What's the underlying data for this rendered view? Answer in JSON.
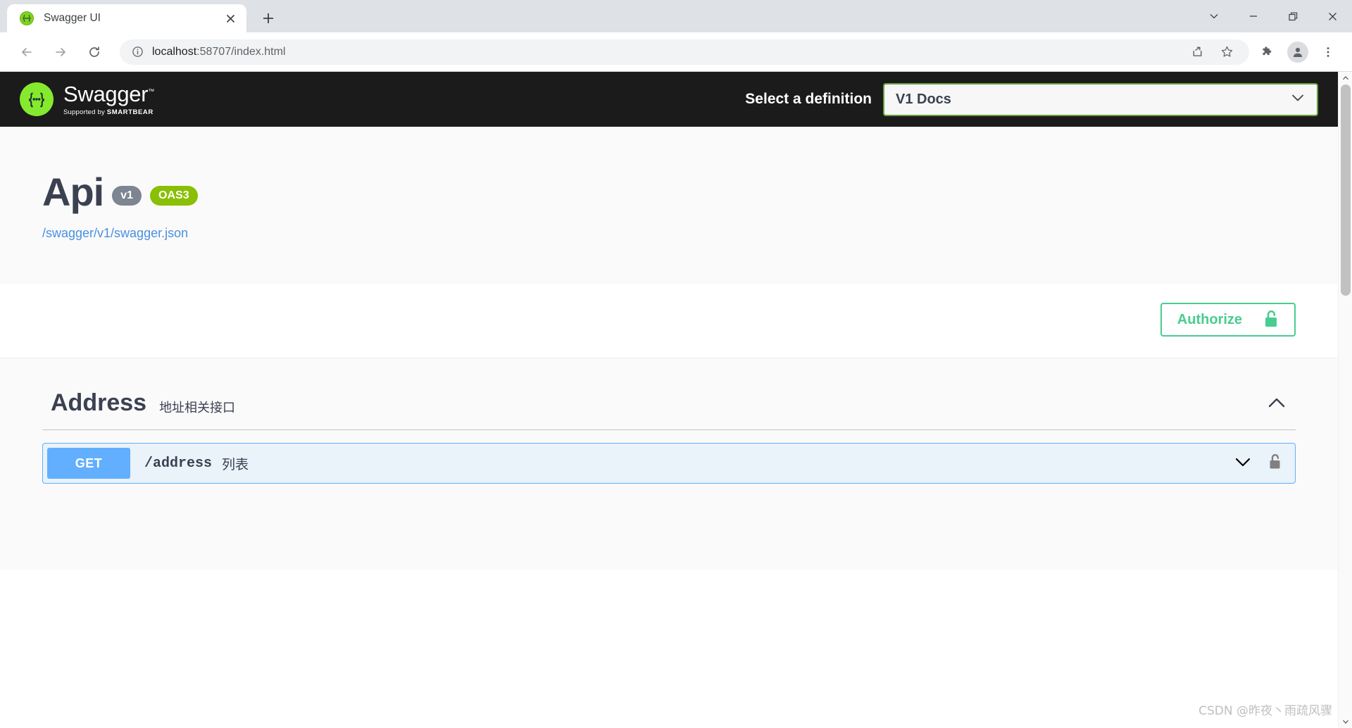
{
  "browser": {
    "tab": {
      "title": "Swagger UI",
      "favicon_icon": "swagger-favicon",
      "close_icon": "close-icon"
    },
    "new_tab_icon": "plus-icon",
    "window_controls": [
      {
        "name": "tab-search",
        "icon": "chevron-down-icon"
      },
      {
        "name": "minimize",
        "icon": "minimize-icon"
      },
      {
        "name": "maximize",
        "icon": "restore-icon"
      },
      {
        "name": "close",
        "icon": "close-icon"
      }
    ],
    "toolbar": {
      "back_icon": "back-arrow-icon",
      "forward_icon": "forward-arrow-icon",
      "reload_icon": "reload-icon",
      "site_info_icon": "info-circle-icon",
      "url_secure_part": "localhost",
      "url_rest": ":58707/index.html",
      "url_full": "localhost:58707/index.html",
      "share_icon": "share-icon",
      "bookmark_icon": "star-icon",
      "extensions_icon": "puzzle-icon",
      "profile_icon": "person-avatar-icon",
      "menu_icon": "three-dot-menu-icon"
    }
  },
  "swagger": {
    "topbar": {
      "logo_text": "Swagger",
      "logo_tm": "™",
      "logo_glyph": "{…}",
      "supported_by_prefix": "Supported by ",
      "supported_by_brand": "SMARTBEAR",
      "definition_label": "Select a definition",
      "definition_value": "V1 Docs",
      "definition_chevron_icon": "chevron-down-icon"
    },
    "info": {
      "title": "Api",
      "version_badge": "v1",
      "oas_badge": "OAS3",
      "spec_link": "/swagger/v1/swagger.json"
    },
    "authorize": {
      "label": "Authorize",
      "lock_icon": "unlocked-padlock-icon"
    },
    "tags": [
      {
        "name": "Address",
        "description": "地址相关接口",
        "toggle_icon": "chevron-up-icon",
        "operations": [
          {
            "method": "GET",
            "path": "/address",
            "summary": "列表",
            "expand_icon": "chevron-down-icon",
            "lock_icon": "unlocked-padlock-icon"
          }
        ]
      }
    ],
    "scrollbar": {
      "up_icon": "scroll-up-arrow",
      "down_icon": "scroll-down-arrow"
    }
  },
  "watermark": "CSDN @昨夜丶雨疏风骤",
  "colors": {
    "swagger_green": "#85EA2D",
    "authorize_green": "#49CC90",
    "get_blue": "#61AFFE",
    "oas_green": "#89BF04",
    "version_gray": "#7D8492",
    "link_blue": "#4990E2",
    "topbar_black": "#1B1B1B",
    "text_dark": "#3B4151"
  }
}
